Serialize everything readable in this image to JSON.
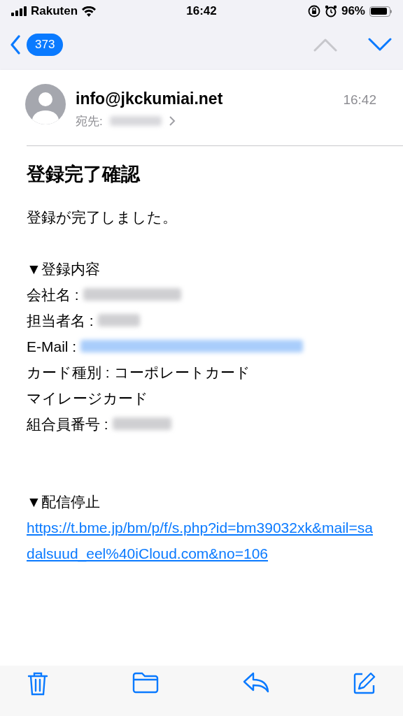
{
  "status_bar": {
    "carrier": "Rakuten",
    "time": "16:42",
    "battery": "96%"
  },
  "nav": {
    "unread_count": "373",
    "prev_disabled": true,
    "next_disabled": false
  },
  "header": {
    "sender": "info@jkckumiai.net",
    "to_label": "宛先:",
    "time": "16:42"
  },
  "subject": "登録完了確認",
  "body": [
    {
      "kind": "text",
      "text": "登録が完了しました。"
    },
    {
      "kind": "gap"
    },
    {
      "kind": "text",
      "text": "▼登録内容"
    },
    {
      "kind": "field",
      "label": "会社名 : "
    },
    {
      "kind": "field",
      "label": "担当者名 : "
    },
    {
      "kind": "email_field",
      "label": "E-Mail : "
    },
    {
      "kind": "text",
      "text": "カード種別 : コーポレートカード"
    },
    {
      "kind": "text",
      "text": "マイレージカード"
    },
    {
      "kind": "field",
      "label": "組合員番号 : "
    },
    {
      "kind": "gap"
    },
    {
      "kind": "gap"
    },
    {
      "kind": "text",
      "text": "▼配信停止"
    },
    {
      "kind": "link",
      "text": "https://t.bme.jp/bm/p/f/s.php?id=bm39032xk&mail=sadalsuud_eel%40iCloud.com&no=106"
    }
  ]
}
